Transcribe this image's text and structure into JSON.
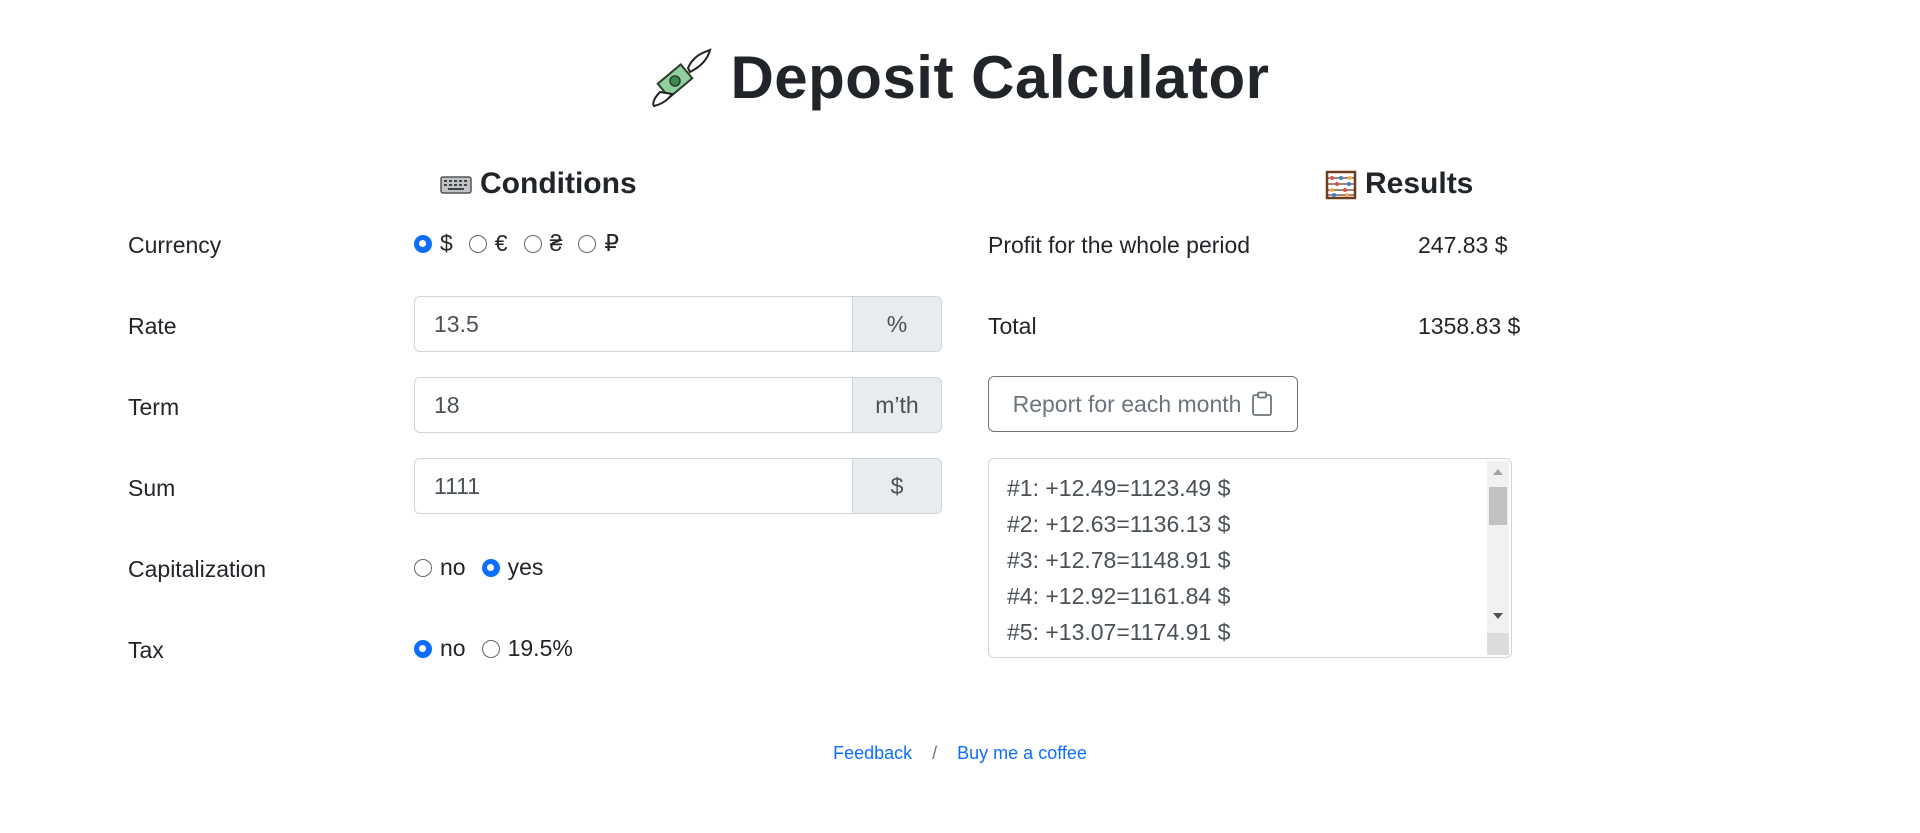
{
  "title": "Deposit Calculator",
  "conditions": {
    "heading": "Conditions",
    "currency": {
      "label": "Currency",
      "options": [
        "$",
        "€",
        "₴",
        "₽"
      ],
      "selected": "$"
    },
    "rate": {
      "label": "Rate",
      "value": "13.5",
      "unit": "%"
    },
    "term": {
      "label": "Term",
      "value": "18",
      "unit": "m’th"
    },
    "sum": {
      "label": "Sum",
      "value": "1111",
      "unit": "$"
    },
    "capitalization": {
      "label": "Capitalization",
      "options": [
        "no",
        "yes"
      ],
      "selected": "yes"
    },
    "tax": {
      "label": "Tax",
      "options": [
        "no",
        "19.5%"
      ],
      "selected": "no"
    }
  },
  "results": {
    "heading": "Results",
    "profit_label": "Profit for the whole period",
    "profit_value": "247.83 $",
    "total_label": "Total",
    "total_value": "1358.83 $",
    "report_button": "Report for each month",
    "report_lines": [
      "#1: +12.49=1123.49 $",
      "#2: +12.63=1136.13 $",
      "#3: +12.78=1148.91 $",
      "#4: +12.92=1161.84 $",
      "#5: +13.07=1174.91 $"
    ]
  },
  "footer": {
    "feedback": "Feedback",
    "separator": "/",
    "coffee": "Buy me a coffee"
  },
  "colors": {
    "accent": "#0d6efd",
    "text": "#212529",
    "muted": "#6c757d",
    "addon_bg": "#e9ecef"
  },
  "icons": {
    "title": "money-with-wings-icon",
    "conditions": "keyboard-icon",
    "results": "abacus-icon",
    "report": "clipboard-icon"
  }
}
